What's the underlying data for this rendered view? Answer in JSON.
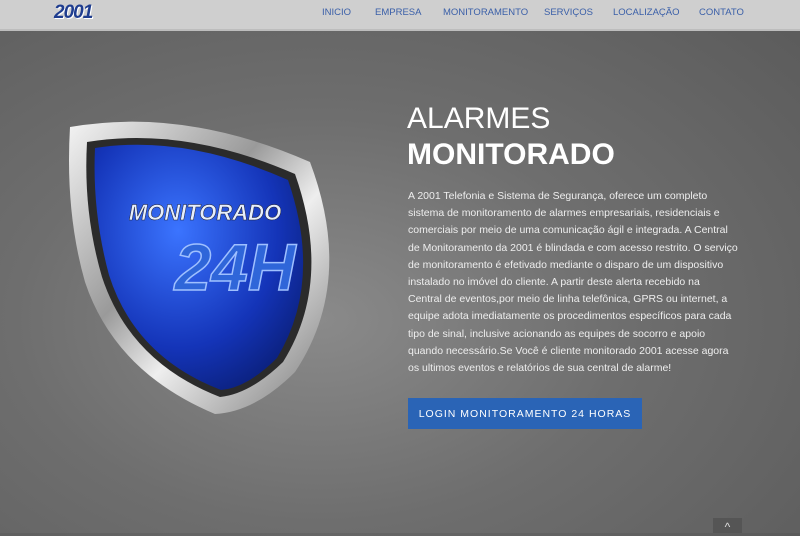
{
  "header": {
    "logo": "2001",
    "menu": [
      "INICIO",
      "EMPRESA",
      "MONITORAMENTO",
      "SERVIÇOS",
      "LOCALIZAÇÃO",
      "CONTATO"
    ]
  },
  "hero": {
    "title_line1": "ALARMES",
    "title_line2": "MONITORADO",
    "shield_text1": "MONITORADO",
    "shield_text2": "24H",
    "paragraph_lines": [
      "A 2001 Telefonia e Sistema de Segurança, oferece um completo",
      "sistema de monitoramento de alarmes empresariais, residenciais e",
      "comerciais por meio de uma comunicação ágil e integrada. A Central",
      "de Monitoramento da 2001 é blindada e com acesso restrito. O serviço",
      "de monitoramento é efetivado mediante o disparo de um dispositivo",
      "instalado no imóvel do cliente. A partir deste alerta recebido na",
      "Central de eventos,por meio de linha telefônica, GPRS ou internet, a",
      "equipe adota imediatamente os procedimentos específicos para cada",
      "tipo de sinal, inclusive acionando as equipes de socorro e apoio",
      "quando necessário.Se Você é cliente monitorado 2001 acesse agora",
      "os ultimos eventos e relatórios de sua central de alarme!"
    ],
    "button": "LOGIN MONITORAMENTO 24 HORAS"
  },
  "scroll_top": {
    "icon": "chevron-up-icon",
    "glyph": "^"
  },
  "colors": {
    "accent": "#2a64b6",
    "nav_text": "#3a5fa8"
  }
}
